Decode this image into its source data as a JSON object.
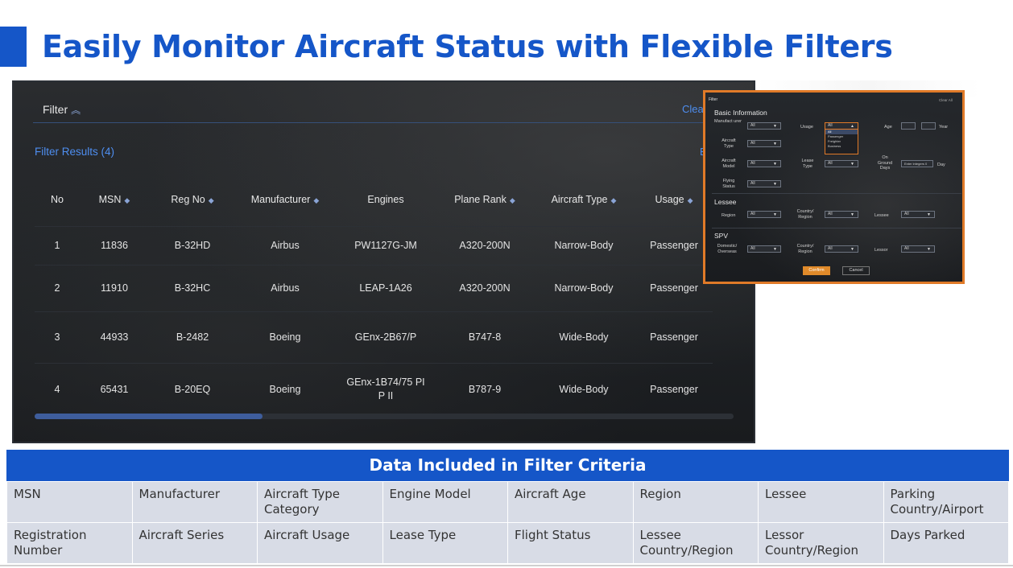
{
  "page": {
    "title": "Easily Monitor Aircraft Status with Flexible Filters"
  },
  "screen": {
    "filter_label": "Filter",
    "clear_label": "Clea",
    "results_label": "Filter Results (4)",
    "export_label": "E",
    "columns": [
      "No",
      "MSN",
      "Reg No",
      "Manufacturer",
      "Engines",
      "Plane Rank",
      "Aircraft Type",
      "Usage"
    ],
    "rows": [
      [
        "1",
        "11836",
        "B-32HD",
        "Airbus",
        "PW1127G-JM",
        "A320-200N",
        "Narrow-Body",
        "Passenger"
      ],
      [
        "2",
        "11910",
        "B-32HC",
        "Airbus",
        "LEAP-1A26",
        "A320-200N",
        "Narrow-Body",
        "Passenger"
      ],
      [
        "3",
        "44933",
        "B-2482",
        "Boeing",
        "GEnx-2B67/P",
        "B747-8",
        "Wide-Body",
        "Passenger"
      ],
      [
        "4",
        "65431",
        "B-20EQ",
        "Boeing",
        "GEnx-1B74/75 PI P II",
        "B787-9",
        "Wide-Body",
        "Passenger"
      ]
    ]
  },
  "panel": {
    "title": "Filter",
    "clear_all": "Clear All",
    "basic_info": "Basic Information",
    "lessee_section": "Lessee",
    "spv_section": "SPV",
    "labels": {
      "manufacturer": "Manufact urer",
      "usage": "Usage",
      "age": "Age",
      "year": "Year",
      "aircraft_type": "Aircraft Type",
      "aircraft_model": "Aircraft Model",
      "lease_type": "Lease Type",
      "on_ground_days": "On Ground Days",
      "day": "Day",
      "flying_status": "Flying Status",
      "region": "Region",
      "country_region": "Country/ Region",
      "lessee": "Lessee",
      "domestic_overseas": "Domestic/ Overseas",
      "country_region_2": "Country/ Region",
      "lessor": "Lessor"
    },
    "select_value": "All",
    "input_placeholder": "Enter integers 0",
    "dropdown_options": [
      "All",
      "Passenger",
      "Freighter",
      "Business"
    ],
    "confirm": "Confirm",
    "cancel": "Cancel"
  },
  "criteria": {
    "heading": "Data Included in Filter Criteria",
    "row1": [
      "MSN",
      "Manufacturer",
      "Aircraft Type Category",
      "Engine Model",
      "Aircraft Age",
      "Region",
      "Lessee",
      "Parking Country/Airport"
    ],
    "row2": [
      "Registration Number",
      "Aircraft Series",
      "Aircraft Usage",
      "Lease Type",
      "Flight Status",
      "Lessee Country/Region",
      "Lessor Country/Region",
      "Days Parked"
    ]
  },
  "colors": {
    "brand_blue": "#1556c8",
    "accent_orange": "#e07a28",
    "link_blue": "#4e8ef0",
    "cell_bg": "#d8dce6"
  }
}
